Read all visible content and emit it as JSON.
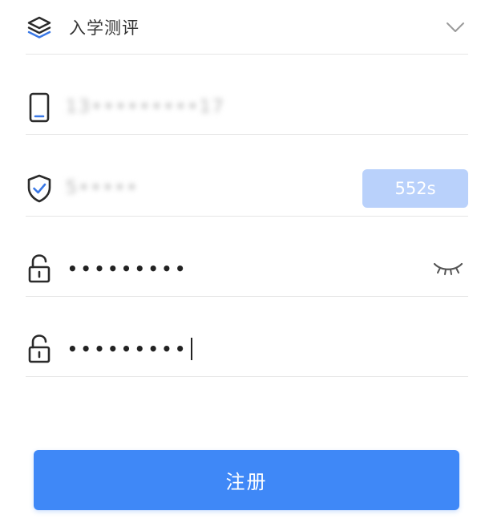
{
  "form": {
    "assessment_select": {
      "label": "入学测评",
      "icon": "layers-icon"
    },
    "phone": {
      "value": "13•••••••••17",
      "icon": "phone-icon"
    },
    "verification": {
      "value": "5•••••",
      "button_label": "552s",
      "icon": "shield-check-icon"
    },
    "password": {
      "value": "•••••••••",
      "icon": "unlock-icon",
      "toggle_icon": "eye-closed-icon"
    },
    "confirm_password": {
      "value": "•••••••••",
      "icon": "unlock-icon"
    },
    "submit_label": "注册"
  },
  "colors": {
    "primary": "#3f88f7",
    "primary_disabled": "#b9d1fb",
    "accent_icon": "#3a78e6",
    "divider": "#e6e6e6",
    "text": "#333333"
  }
}
